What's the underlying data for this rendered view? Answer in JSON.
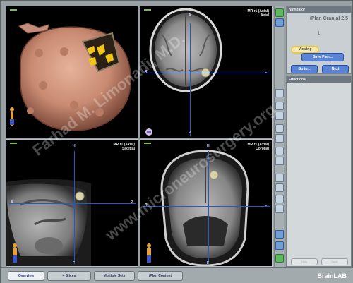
{
  "viewports": {
    "axial": {
      "line1": "MR r1 (Axial)",
      "line2": "Axial"
    },
    "sagittal": {
      "line1": "MR r1 (Axial)",
      "line2": "Sagittal"
    },
    "coronal": {
      "line1": "MR r1 (Axial)",
      "line2": "Coronal"
    }
  },
  "orientation": {
    "axial": {
      "top": "A",
      "bottom": "P",
      "left": "R",
      "right": "L"
    },
    "sagittal": {
      "top": "H",
      "bottom": "F",
      "left": "A",
      "right": "P"
    },
    "coronal": {
      "top": "H",
      "bottom": "F",
      "left": "R",
      "right": "L"
    }
  },
  "navigator": {
    "header": "Navigator",
    "app_title": "iPlan Cranial 2.5",
    "step": "1",
    "viewing_label": "Viewing",
    "save_plan_label": "Save Plan...",
    "goto_label": "Go to...",
    "next_label": "Next"
  },
  "functions": {
    "header": "Functions",
    "btn_left": "Help",
    "btn_right": "Done"
  },
  "tabs": {
    "overview": "Overview",
    "slices": "4 Slices",
    "multiple": "Multiple Sets",
    "iplan": "iPlan Content"
  },
  "brand": "BrainLAB",
  "watermarks": [
    "Farhad M. Limonadi, M.D.",
    "www.microneurosurgery.org"
  ],
  "colors": {
    "crosshair": "#1e59d8",
    "accent_button": "#5a85d6",
    "viewing_highlight": "#e6c84a"
  }
}
